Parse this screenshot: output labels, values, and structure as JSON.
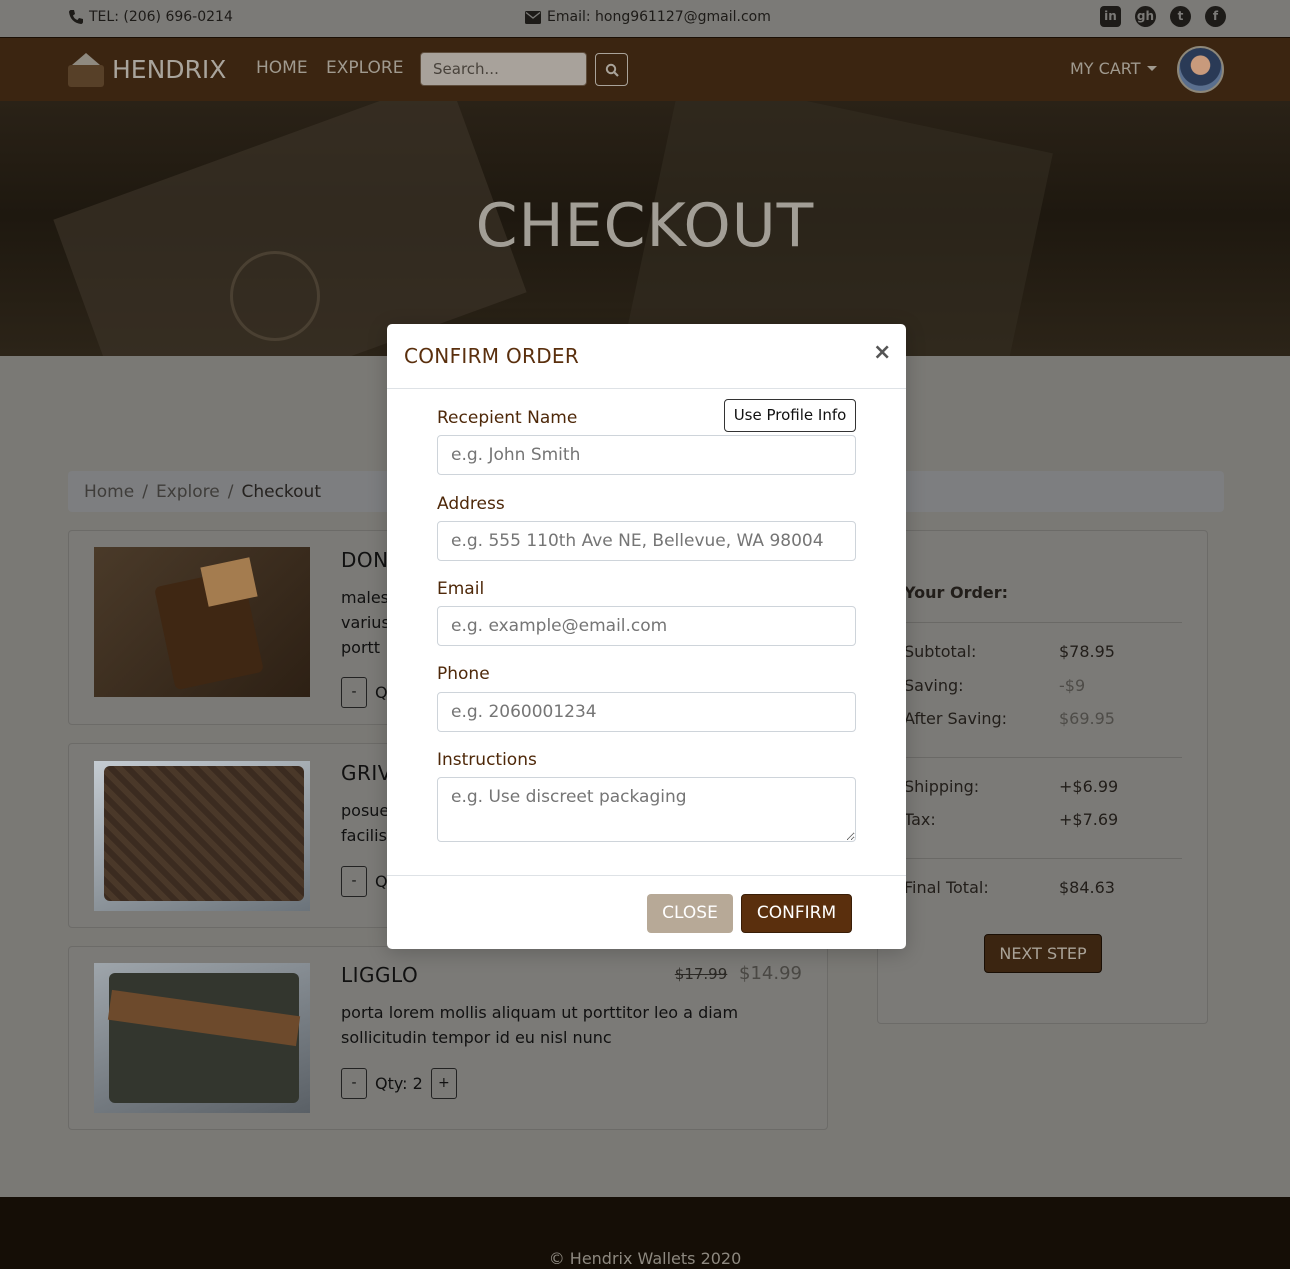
{
  "topbar": {
    "tel": "TEL: (206) 696-0214",
    "email": "Email: hong961127@gmail.com",
    "social_icons": [
      "linkedin-icon",
      "github-icon",
      "twitter-icon",
      "facebook-icon"
    ]
  },
  "navbar": {
    "brand": "HENDRIX",
    "links": [
      "HOME",
      "EXPLORE"
    ],
    "search_placeholder": "Search...",
    "cart_label": "MY CART"
  },
  "hero": {
    "title": "CHECKOUT"
  },
  "breadcrumb": [
    "Home",
    "Explore",
    "Checkout"
  ],
  "products": [
    {
      "name": "DON",
      "desc_lines": [
        "males",
        "varius",
        "portt"
      ],
      "qty_prefix": "Q"
    },
    {
      "name": "GRIV",
      "desc_lines": [
        "posue",
        "facilis"
      ],
      "qty_prefix": "Q"
    },
    {
      "name": "LIGGLO",
      "old_price": "$17.99",
      "price": "$14.99",
      "desc": "porta lorem mollis aliquam ut porttitor leo a diam sollicitudin tempor id eu nisl nunc",
      "qty": "Qty: 2"
    }
  ],
  "qty_minus": "-",
  "qty_plus": "+",
  "summary": {
    "title": "Your Order:",
    "subtotal_label": "Subtotal:",
    "subtotal": "$78.95",
    "saving_label": "Saving:",
    "saving": "-$9",
    "after_label": "After Saving:",
    "after": "$69.95",
    "shipping_label": "Shipping:",
    "shipping": "+$6.99",
    "tax_label": "Tax:",
    "tax": "+$7.69",
    "final_label": "Final Total:",
    "final": "$84.63",
    "next_button": "NEXT STEP"
  },
  "footer": {
    "copyright": "© Hendrix Wallets 2020"
  },
  "modal": {
    "title": "CONFIRM ORDER",
    "close_symbol": "×",
    "profile_button": "Use Profile Info",
    "fields": {
      "name_label": "Recepient Name",
      "name_placeholder": "e.g. John Smith",
      "address_label": "Address",
      "address_placeholder": "e.g. 555 110th Ave NE, Bellevue, WA 98004",
      "email_label": "Email",
      "email_placeholder": "e.g. example@email.com",
      "phone_label": "Phone",
      "phone_placeholder": "e.g. 2060001234",
      "instructions_label": "Instructions",
      "instructions_placeholder": "e.g. Use discreet packaging"
    },
    "close_button": "CLOSE",
    "confirm_button": "CONFIRM"
  }
}
